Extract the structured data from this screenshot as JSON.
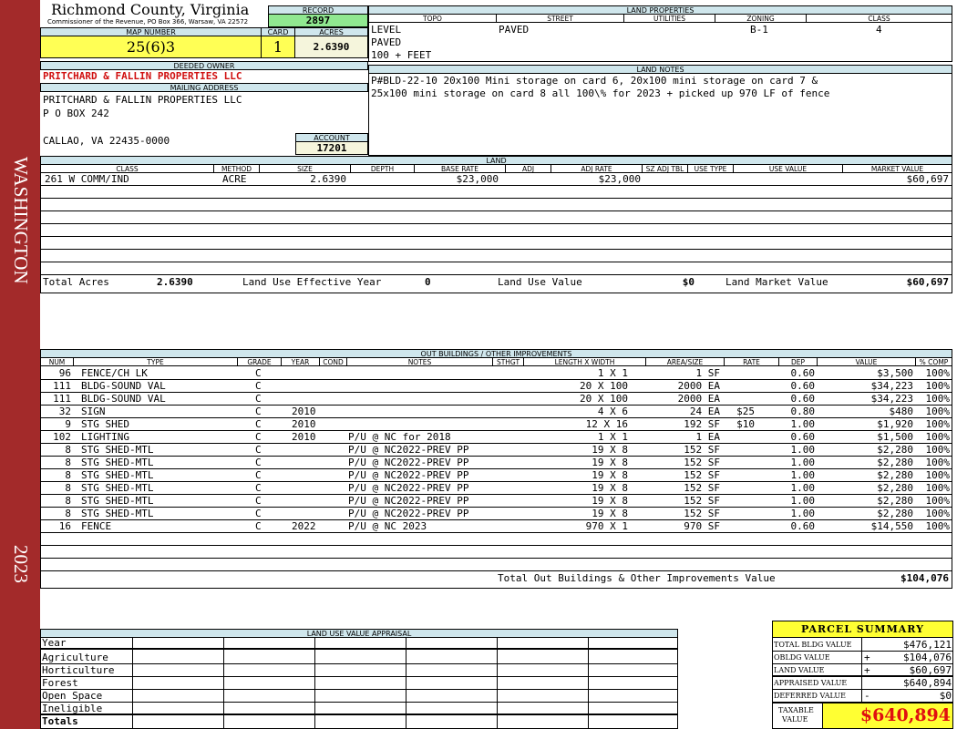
{
  "sidebar": {
    "district": "WASHINGTON",
    "year": "2023",
    "color": "#a32a2a"
  },
  "header": {
    "county": "Richmond County, Virginia",
    "office": "Commissioner of the Revenue, PO Box 366, Warsaw, VA 22572",
    "record_label": "RECORD",
    "record": "2897",
    "map_label": "MAP NUMBER",
    "map_number": "25(6)3",
    "card_label": "CARD",
    "card": "1",
    "acres_label": "ACRES",
    "acres": "2.6390"
  },
  "owner": {
    "deeded_label": "DEEDED OWNER",
    "deeded_owner": "PRITCHARD & FALLIN PROPERTIES LLC",
    "mailing_label": "MAILING ADDRESS",
    "address": [
      "PRITCHARD & FALLIN PROPERTIES LLC",
      "P O BOX 242",
      "",
      "CALLAO, VA 22435-0000"
    ],
    "account_label": "ACCOUNT",
    "account": "17201"
  },
  "land_properties": {
    "title": "LAND PROPERTIES",
    "headers": [
      "TOPO",
      "STREET",
      "UTILITIES",
      "ZONING",
      "CLASS"
    ],
    "topo": [
      "LEVEL",
      "PAVED",
      "100 + FEET"
    ],
    "street": "PAVED",
    "zoning": "B-1",
    "class": "4"
  },
  "land_notes": {
    "title": "LAND NOTES",
    "lines": [
      "P#BLD-22-10 20x100 Mini storage on card 6, 20x100 mini storage on card 7 &",
      "25x100 mini storage on card 8 all 100\\% for 2023 + picked up 970 LF of fence"
    ]
  },
  "land": {
    "title": "LAND",
    "headers": [
      "CLASS",
      "METHOD",
      "SIZE",
      "DEPTH",
      "BASE RATE",
      "ADJ",
      "ADJ RATE",
      "SZ ADJ TBL",
      "USE TYPE",
      "USE VALUE",
      "MARKET VALUE"
    ],
    "row": {
      "class": "261 W COMM/IND",
      "method": "ACRE",
      "size": "2.6390",
      "base_rate": "$23,000",
      "adj_rate": "$23,000",
      "market_value": "$60,697"
    },
    "total_acres_label": "Total Acres",
    "total_acres": "2.6390",
    "effective_year_label": "Land Use Effective Year",
    "effective_year": "0",
    "use_value_label": "Land Use Value",
    "use_value": "$0",
    "market_value_label": "Land Market Value",
    "market_value": "$60,697"
  },
  "outbuildings": {
    "title": "OUT BUILDINGS / OTHER IMPROVEMENTS",
    "headers": [
      "NUM",
      "TYPE",
      "GRADE",
      "YEAR",
      "COND",
      "NOTES",
      "STHGT",
      "LENGTH X WIDTH",
      "AREA/SIZE",
      "RATE",
      "DEP",
      "VALUE",
      "% COMP"
    ],
    "rows": [
      {
        "num": "96",
        "type": "FENCE/CH LK",
        "grade": "C",
        "year": "",
        "notes": "",
        "lw": "1 X 1",
        "area": "1 SF",
        "rate": "",
        "dep": "0.60",
        "value": "$3,500",
        "comp": "100%"
      },
      {
        "num": "111",
        "type": "BLDG-SOUND VAL",
        "grade": "C",
        "year": "",
        "notes": "",
        "lw": "20 X 100",
        "area": "2000 EA",
        "rate": "",
        "dep": "0.60",
        "value": "$34,223",
        "comp": "100%"
      },
      {
        "num": "111",
        "type": "BLDG-SOUND VAL",
        "grade": "C",
        "year": "",
        "notes": "",
        "lw": "20 X 100",
        "area": "2000 EA",
        "rate": "",
        "dep": "0.60",
        "value": "$34,223",
        "comp": "100%"
      },
      {
        "num": "32",
        "type": "SIGN",
        "grade": "C",
        "year": "2010",
        "notes": "",
        "lw": "4 X 6",
        "area": "24 EA",
        "rate": "$25",
        "dep": "0.80",
        "value": "$480",
        "comp": "100%"
      },
      {
        "num": "9",
        "type": "STG SHED",
        "grade": "C",
        "year": "2010",
        "notes": "",
        "lw": "12 X 16",
        "area": "192 SF",
        "rate": "$10",
        "dep": "1.00",
        "value": "$1,920",
        "comp": "100%"
      },
      {
        "num": "102",
        "type": "LIGHTING",
        "grade": "C",
        "year": "2010",
        "notes": "P/U @ NC for 2018",
        "lw": "1 X 1",
        "area": "1 EA",
        "rate": "",
        "dep": "0.60",
        "value": "$1,500",
        "comp": "100%"
      },
      {
        "num": "8",
        "type": "STG SHED-MTL",
        "grade": "C",
        "year": "",
        "notes": "P/U @ NC2022-PREV PP",
        "lw": "19 X 8",
        "area": "152 SF",
        "rate": "",
        "dep": "1.00",
        "value": "$2,280",
        "comp": "100%"
      },
      {
        "num": "8",
        "type": "STG SHED-MTL",
        "grade": "C",
        "year": "",
        "notes": "P/U @ NC2022-PREV PP",
        "lw": "19 X 8",
        "area": "152 SF",
        "rate": "",
        "dep": "1.00",
        "value": "$2,280",
        "comp": "100%"
      },
      {
        "num": "8",
        "type": "STG SHED-MTL",
        "grade": "C",
        "year": "",
        "notes": "P/U @ NC2022-PREV PP",
        "lw": "19 X 8",
        "area": "152 SF",
        "rate": "",
        "dep": "1.00",
        "value": "$2,280",
        "comp": "100%"
      },
      {
        "num": "8",
        "type": "STG SHED-MTL",
        "grade": "C",
        "year": "",
        "notes": "P/U @ NC2022-PREV PP",
        "lw": "19 X 8",
        "area": "152 SF",
        "rate": "",
        "dep": "1.00",
        "value": "$2,280",
        "comp": "100%"
      },
      {
        "num": "8",
        "type": "STG SHED-MTL",
        "grade": "C",
        "year": "",
        "notes": "P/U @ NC2022-PREV PP",
        "lw": "19 X 8",
        "area": "152 SF",
        "rate": "",
        "dep": "1.00",
        "value": "$2,280",
        "comp": "100%"
      },
      {
        "num": "8",
        "type": "STG SHED-MTL",
        "grade": "C",
        "year": "",
        "notes": "P/U @ NC2022-PREV PP",
        "lw": "19 X 8",
        "area": "152 SF",
        "rate": "",
        "dep": "1.00",
        "value": "$2,280",
        "comp": "100%"
      },
      {
        "num": "16",
        "type": "FENCE",
        "grade": "C",
        "year": "2022",
        "notes": "P/U @ NC 2023",
        "lw": "970 X 1",
        "area": "970 SF",
        "rate": "",
        "dep": "0.60",
        "value": "$14,550",
        "comp": "100%"
      }
    ],
    "total_label": "Total Out Buildings & Other Improvements Value",
    "total": "$104,076"
  },
  "land_use_appraisal": {
    "title": "LAND USE VALUE APPRAISAL",
    "rows": [
      "Year",
      "Agriculture",
      "Horticulture",
      "Forest",
      "Open Space",
      "Ineligible",
      "Totals"
    ]
  },
  "parcel_summary": {
    "title": "PARCEL SUMMARY",
    "rows": [
      {
        "label": "TOTAL BLDG VALUE",
        "sign": "",
        "value": "$476,121"
      },
      {
        "label": "OBLDG VALUE",
        "sign": "+",
        "value": "$104,076"
      },
      {
        "label": "LAND VALUE",
        "sign": "+",
        "value": "$60,697"
      },
      {
        "label": "APPRAISED VALUE",
        "sign": "",
        "value": "$640,894"
      },
      {
        "label": "DEFERRED VALUE",
        "sign": "-",
        "value": "$0"
      }
    ],
    "taxable_label_1": "TAXABLE",
    "taxable_label_2": "VALUE",
    "taxable_value": "$640,894",
    "highlight_color": "#ffff33",
    "taxable_color": "#e01010"
  }
}
